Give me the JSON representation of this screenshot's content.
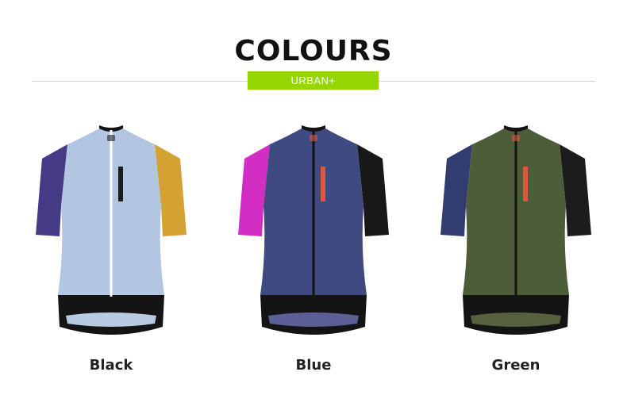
{
  "heading": "COLOURS",
  "subheading": "URBAN+",
  "accent_color": "#95d600",
  "products": [
    {
      "label": "Black",
      "colors": {
        "body": "#b2c6e2",
        "left_sleeve": "#443a85",
        "right_sleeve": "#d4a232",
        "hem": "#141414",
        "zip": "#ffffff",
        "logo": "#1d1d1d",
        "inner": "#b9cbe0"
      }
    },
    {
      "label": "Blue",
      "colors": {
        "body": "#3f4a80",
        "left_sleeve": "#d32ec4",
        "right_sleeve": "#181818",
        "hem": "#141414",
        "zip": "#121212",
        "logo": "#e2563d",
        "inner": "#5b5f95"
      }
    },
    {
      "label": "Green",
      "colors": {
        "body": "#4d5d39",
        "left_sleeve": "#333c70",
        "right_sleeve": "#1c1c1c",
        "hem": "#141414",
        "zip": "#121212",
        "logo": "#e2563d",
        "inner": "#56603f"
      }
    }
  ]
}
